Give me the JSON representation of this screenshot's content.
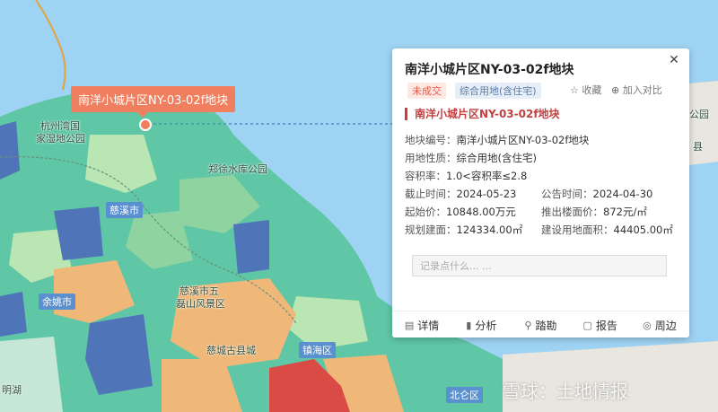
{
  "map": {
    "labels": [
      "杭州湾国",
      "家湿地公园",
      "郑徐水库公园",
      "慈溪市五",
      "磊山风景区",
      "慈城古县城",
      "明湖",
      "公园",
      "县"
    ],
    "district_badges": [
      "慈溪市",
      "余姚市",
      "镇海区",
      "北仑区"
    ],
    "colors": {
      "sea": "#9fd3f3",
      "land_teal": "#5fc6a6",
      "land_green": "#8fd4a0",
      "land_light": "#b9e6b3",
      "orange": "#efb879",
      "dark_blue": "#4f74b8",
      "red": "#d94b44",
      "grey_land": "#e8e6df"
    }
  },
  "callout": {
    "label": "南洋小城片区NY-03-02f地块"
  },
  "panel": {
    "title": "南洋小城片区NY-03-02f地块",
    "close_icon": "close-icon",
    "tags": [
      "未成交",
      "综合用地(含住宅)"
    ],
    "favorite_label": "收藏",
    "compare_label": "加入对比",
    "subtitle": "南洋小城片区NY-03-02f地块",
    "fields": {
      "plot_no_label": "地块编号：",
      "plot_no": "南洋小城片区NY-03-02f地块",
      "use_label": "用地性质：",
      "use": "综合用地(含住宅)",
      "far_label": "容积率：",
      "far": "1.0<容积率≤2.8",
      "deadline_label": "截止时间：",
      "deadline": "2024-05-23",
      "announce_label": "公告时间：",
      "announce": "2024-04-30",
      "start_price_label": "起始价：",
      "start_price": "10848.00万元",
      "floor_price_label": "推出楼面价：",
      "floor_price": "872元/㎡",
      "build_area_label": "规划建面：",
      "build_area": "124334.00㎡",
      "land_area_label": "建设用地面积：",
      "land_area": "44405.00㎡"
    },
    "note_placeholder": "记录点什么... ...",
    "footer": [
      {
        "icon": "detail-icon",
        "glyph": "▤",
        "label": "详情"
      },
      {
        "icon": "chart-icon",
        "glyph": "▮",
        "label": "分析"
      },
      {
        "icon": "survey-icon",
        "glyph": "⚲",
        "label": "踏勘"
      },
      {
        "icon": "report-icon",
        "glyph": "▢",
        "label": "报告"
      },
      {
        "icon": "nearby-icon",
        "glyph": "◎",
        "label": "周边"
      }
    ]
  },
  "watermark": "雪球：土地情报"
}
